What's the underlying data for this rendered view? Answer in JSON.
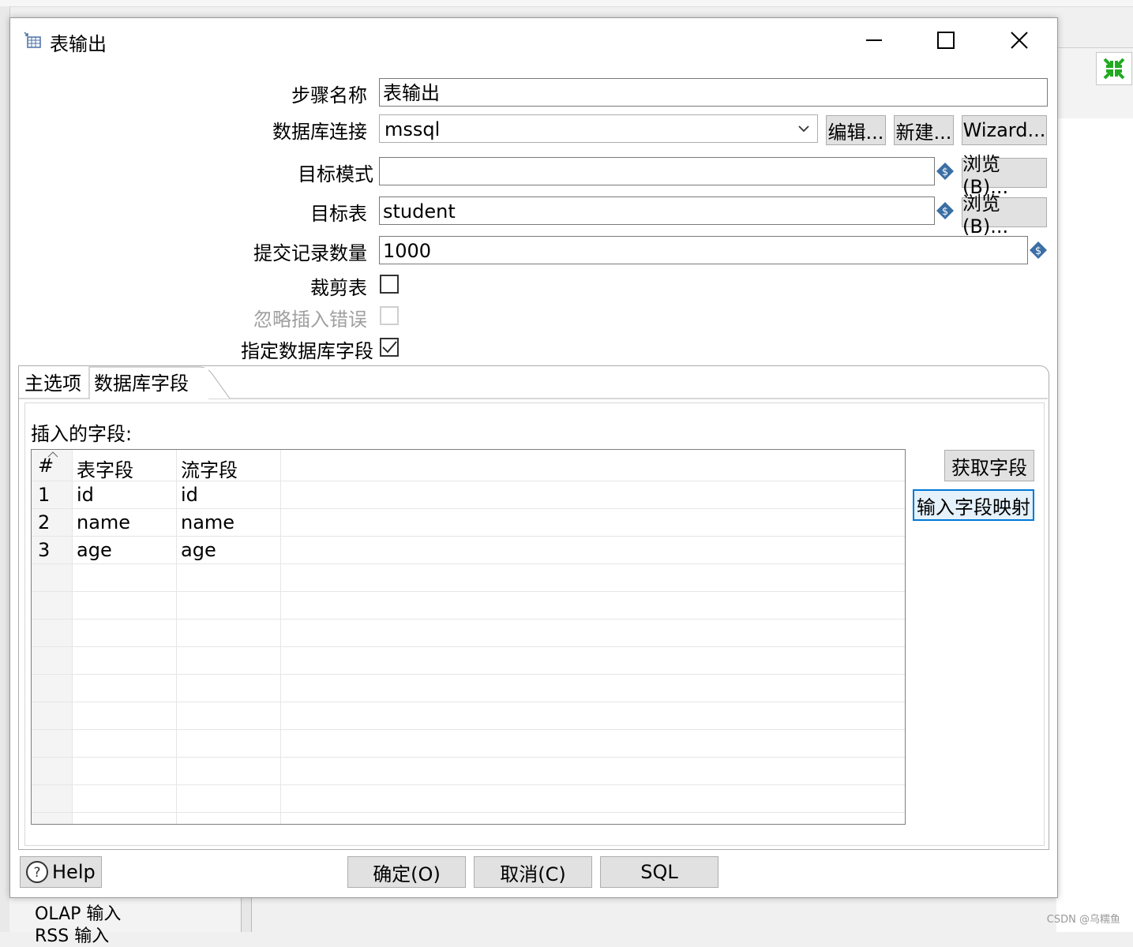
{
  "dialog": {
    "title": "表输出"
  },
  "form": {
    "step_name_label": "步骤名称",
    "step_name_value": "表输出",
    "db_conn_label": "数据库连接",
    "db_conn_value": "mssql",
    "edit_btn": "编辑...",
    "new_btn": "新建...",
    "wizard_btn": "Wizard...",
    "target_schema_label": "目标模式",
    "target_schema_value": "",
    "browse_btn_1": "浏览(B)...",
    "target_table_label": "目标表",
    "target_table_value": "student",
    "browse_btn_2": "浏览(B)...",
    "commit_size_label": "提交记录数量",
    "commit_size_value": "1000",
    "truncate_label": "裁剪表",
    "truncate_checked": false,
    "ignore_errors_label": "忽略插入错误",
    "ignore_errors_checked": false,
    "specify_fields_label": "指定数据库字段",
    "specify_fields_checked": true
  },
  "tabs": [
    {
      "label": "主选项",
      "active": false
    },
    {
      "label": "数据库字段",
      "active": true
    }
  ],
  "fields_panel": {
    "label": "插入的字段:",
    "get_fields_btn": "获取字段",
    "input_mapping_btn": "输入字段映射",
    "columns": [
      "#",
      "表字段",
      "流字段"
    ],
    "rows": [
      {
        "num": "1",
        "table_field": "id",
        "stream_field": "id"
      },
      {
        "num": "2",
        "table_field": "name",
        "stream_field": "name"
      },
      {
        "num": "3",
        "table_field": "age",
        "stream_field": "age"
      }
    ]
  },
  "footer": {
    "help_btn": "Help",
    "ok_btn": "确定(O)",
    "cancel_btn": "取消(C)",
    "sql_btn": "SQL"
  },
  "background": {
    "bottom_item_1": "OLAP 输入",
    "bottom_item_2": "RSS 输入",
    "watermark": "CSDN @乌糯鱼"
  }
}
